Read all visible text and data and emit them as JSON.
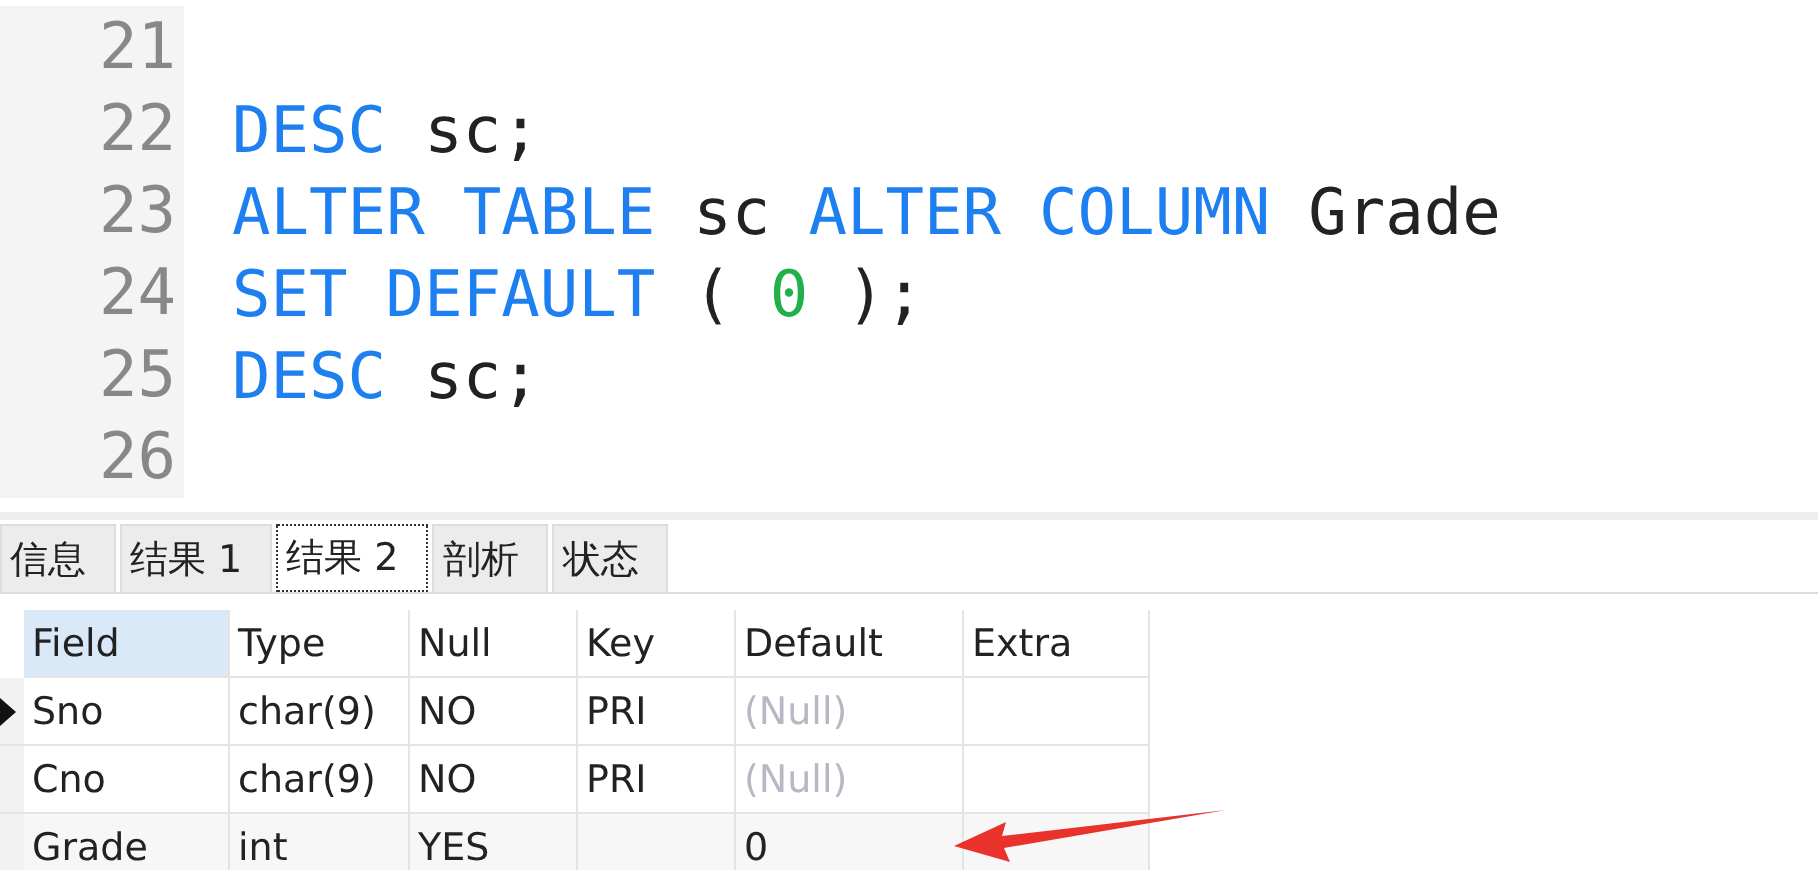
{
  "editor": {
    "lines": [
      {
        "number": "21"
      },
      {
        "number": "22",
        "tokens": [
          {
            "kind": "keyword",
            "text": "DESC"
          },
          {
            "kind": "plain",
            "text": "sc;"
          }
        ]
      },
      {
        "number": "23",
        "tokens": [
          {
            "kind": "keyword",
            "text": "ALTER"
          },
          {
            "kind": "keyword",
            "text": "TABLE"
          },
          {
            "kind": "plain",
            "text": "sc"
          },
          {
            "kind": "keyword",
            "text": "ALTER"
          },
          {
            "kind": "keyword",
            "text": "COLUMN"
          },
          {
            "kind": "plain",
            "text": "Grade"
          }
        ]
      },
      {
        "number": "24",
        "tokens": [
          {
            "kind": "keyword",
            "text": "SET"
          },
          {
            "kind": "keyword",
            "text": "DEFAULT"
          },
          {
            "kind": "plain",
            "text": "("
          },
          {
            "kind": "number",
            "text": "0"
          },
          {
            "kind": "plain",
            "text": ");"
          }
        ]
      },
      {
        "number": "25",
        "tokens": [
          {
            "kind": "keyword",
            "text": "DESC"
          },
          {
            "kind": "plain",
            "text": "sc;"
          }
        ]
      },
      {
        "number": "26"
      }
    ]
  },
  "tabs": [
    {
      "label": "信息",
      "selected": false
    },
    {
      "label": "结果 1",
      "selected": false
    },
    {
      "label": "结果 2",
      "selected": true
    },
    {
      "label": "剖析",
      "selected": false
    },
    {
      "label": "状态",
      "selected": false
    }
  ],
  "table": {
    "columns": [
      {
        "label": "Field",
        "selected": true
      },
      {
        "label": "Type",
        "selected": false
      },
      {
        "label": "Null",
        "selected": false
      },
      {
        "label": "Key",
        "selected": false
      },
      {
        "label": "Default",
        "selected": false
      },
      {
        "label": "Extra",
        "selected": false
      }
    ],
    "rows": [
      {
        "current": true,
        "cells": [
          {
            "kind": "value",
            "text": "Sno"
          },
          {
            "kind": "value",
            "text": "char(9)"
          },
          {
            "kind": "value",
            "text": "NO"
          },
          {
            "kind": "value",
            "text": "PRI"
          },
          {
            "kind": "null",
            "text": "(Null)"
          },
          {
            "kind": "empty"
          }
        ]
      },
      {
        "current": false,
        "cells": [
          {
            "kind": "value",
            "text": "Cno"
          },
          {
            "kind": "value",
            "text": "char(9)"
          },
          {
            "kind": "value",
            "text": "NO"
          },
          {
            "kind": "value",
            "text": "PRI"
          },
          {
            "kind": "null",
            "text": "(Null)"
          },
          {
            "kind": "empty"
          }
        ]
      },
      {
        "current": false,
        "cells": [
          {
            "kind": "value",
            "text": "Grade"
          },
          {
            "kind": "value",
            "text": "int"
          },
          {
            "kind": "value",
            "text": "YES"
          },
          {
            "kind": "empty"
          },
          {
            "kind": "value",
            "text": "0"
          },
          {
            "kind": "empty"
          }
        ]
      }
    ]
  }
}
